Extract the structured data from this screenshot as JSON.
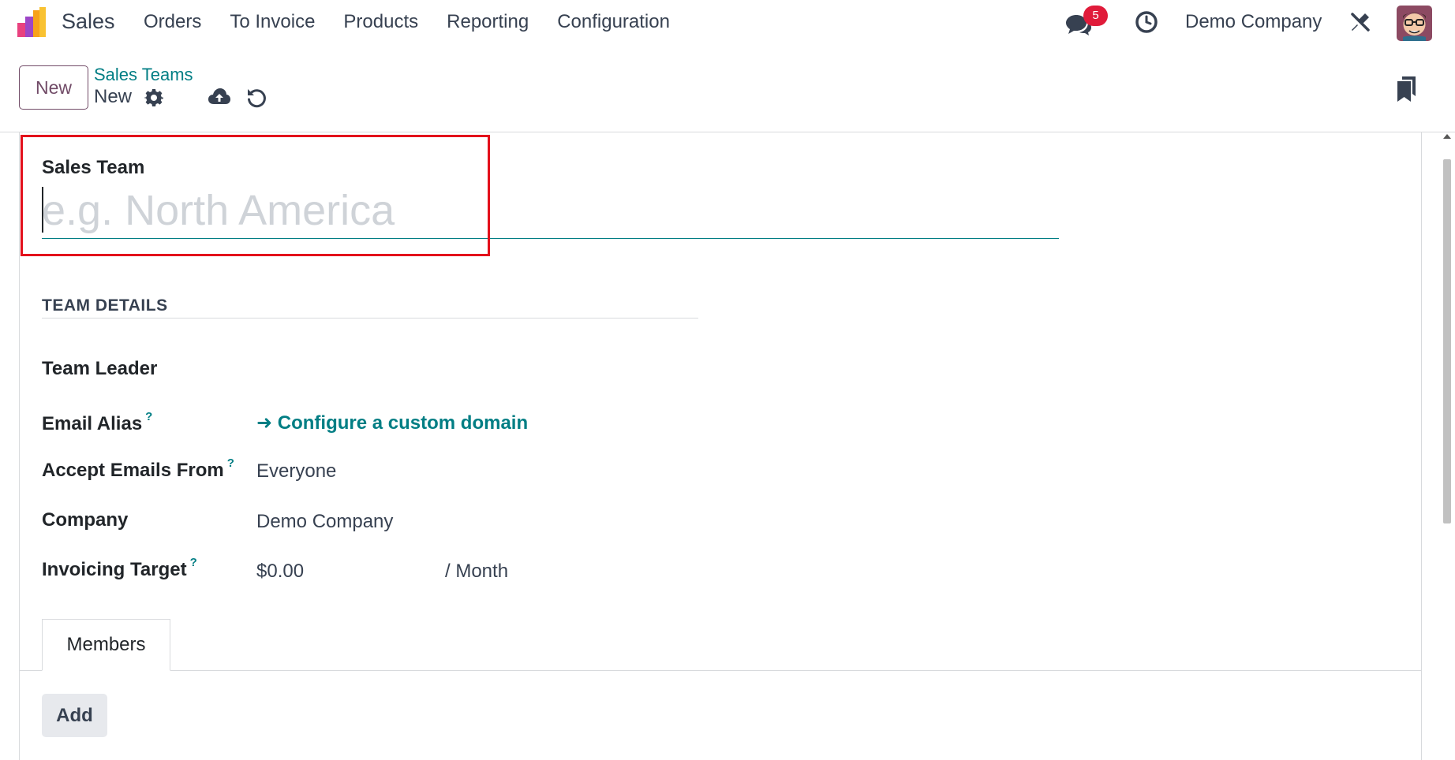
{
  "navbar": {
    "app_name": "Sales",
    "menu": [
      "Orders",
      "To Invoice",
      "Products",
      "Reporting",
      "Configuration"
    ],
    "chat_badge": "5",
    "company": "Demo Company"
  },
  "control_panel": {
    "new_label": "New",
    "breadcrumb_parent": "Sales Teams",
    "breadcrumb_current": "New"
  },
  "form": {
    "sales_team_label": "Sales Team",
    "sales_team_placeholder": "e.g. North America",
    "section_title": "TEAM DETAILS",
    "fields": {
      "team_leader_label": "Team Leader",
      "email_alias_label": "Email Alias",
      "email_alias_help": "?",
      "configure_domain_link": "➜ Configure a custom domain",
      "accept_emails_label": "Accept Emails From",
      "accept_emails_help": "?",
      "accept_emails_value": "Everyone",
      "company_label": "Company",
      "company_value": "Demo Company",
      "invoicing_target_label": "Invoicing Target",
      "invoicing_target_help": "?",
      "invoicing_target_value": "$0.00",
      "invoicing_target_period": "/ Month"
    },
    "tabs": [
      "Members"
    ],
    "add_label": "Add"
  },
  "colors": {
    "brand": "#714B67",
    "link": "#017e84",
    "highlight": "#e3101b",
    "badge": "#e01b3a"
  }
}
